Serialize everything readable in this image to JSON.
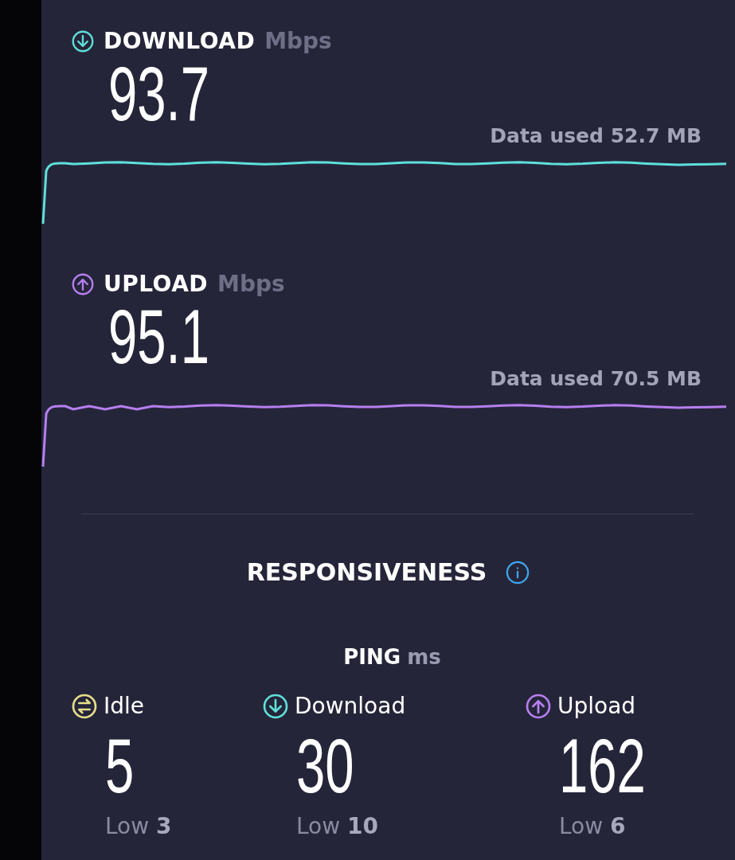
{
  "speeds": [
    {
      "kind": "download",
      "label": "DOWNLOAD",
      "unit": "Mbps",
      "value": "93.7",
      "data_used": "Data used 52.7 MB",
      "color": "#5ee0d8"
    },
    {
      "kind": "upload",
      "label": "UPLOAD",
      "unit": "Mbps",
      "value": "95.1",
      "data_used": "Data used 70.5 MB",
      "color": "#b67ff0"
    }
  ],
  "responsiveness": {
    "title": "RESPONSIVENESS"
  },
  "ping": {
    "label": "PING",
    "unit": "ms",
    "items": [
      {
        "kind": "idle",
        "label": "Idle",
        "value": "5",
        "low": "Low **3**",
        "color": "#e6df8a"
      },
      {
        "kind": "download",
        "label": "Download",
        "value": "30",
        "low": "Low **10**",
        "color": "#5ee0d8"
      },
      {
        "kind": "upload",
        "label": "Upload",
        "value": "162",
        "low": "Low **6**",
        "color": "#b67ff0"
      }
    ]
  }
}
